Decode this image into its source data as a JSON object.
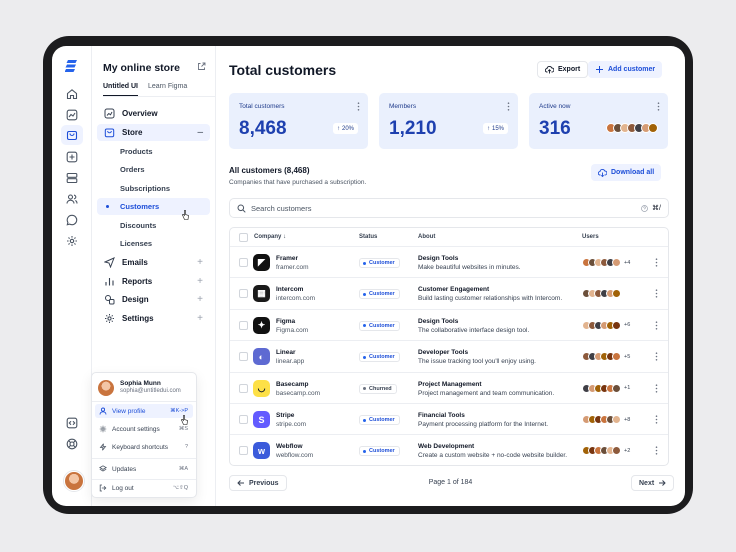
{
  "sidebar": {
    "store_title": "My online store",
    "tabs": [
      "Untitled UI",
      "Learn Figma"
    ],
    "nav": {
      "overview": "Overview",
      "store": "Store",
      "store_toggle": "–",
      "products": "Products",
      "orders": "Orders",
      "subscriptions": "Subscriptions",
      "customers": "Customers",
      "discounts": "Discounts",
      "licenses": "Licenses",
      "emails": "Emails",
      "reports": "Reports",
      "design": "Design",
      "settings": "Settings",
      "plus": "+"
    }
  },
  "account_menu": {
    "name": "Sophia Munn",
    "email": "sophia@untitledui.com",
    "items": [
      {
        "label": "View profile",
        "shortcut": "⌘K->P"
      },
      {
        "label": "Account settings",
        "shortcut": "⌘S"
      },
      {
        "label": "Keyboard shortcuts",
        "shortcut": "?"
      },
      {
        "label": "Updates",
        "shortcut": "⌘A"
      },
      {
        "label": "Log out",
        "shortcut": "⌥⇧Q"
      }
    ]
  },
  "header": {
    "title": "Total customers",
    "export_label": "Export",
    "add_label": "Add customer"
  },
  "stats": [
    {
      "label": "Total customers",
      "value": "8,468",
      "change": "20%"
    },
    {
      "label": "Members",
      "value": "1,210",
      "change": "15%"
    },
    {
      "label": "Active now",
      "value": "316"
    }
  ],
  "list": {
    "title": "All customers (8,468)",
    "subtitle": "Companies that have purchased a subscription.",
    "download_label": "Download all",
    "search_placeholder": "Search customers",
    "search_shortcut": "⌘/"
  },
  "table": {
    "columns": {
      "company": "Company",
      "status": "Status",
      "about": "About",
      "users": "Users"
    },
    "rows": [
      {
        "name": "Framer",
        "domain": "framer.com",
        "status": "Customer",
        "about_title": "Design Tools",
        "about_desc": "Make beautiful websites in minutes.",
        "more": "+4",
        "logo_color": "#111111",
        "logo_glyph": "◤"
      },
      {
        "name": "Intercom",
        "domain": "intercom.com",
        "status": "Customer",
        "about_title": "Customer Engagement",
        "about_desc": "Build lasting customer relationships with Intercom.",
        "more": "",
        "logo_color": "#1a1a1a",
        "logo_glyph": "▦"
      },
      {
        "name": "Figma",
        "domain": "Figma.com",
        "status": "Customer",
        "about_title": "Design Tools",
        "about_desc": "The collaborative interface design tool.",
        "more": "+6",
        "logo_color": "#111111",
        "logo_glyph": "✦"
      },
      {
        "name": "Linear",
        "domain": "linear.app",
        "status": "Customer",
        "about_title": "Developer Tools",
        "about_desc": "The issue tracking tool you'll enjoy using.",
        "more": "+5",
        "logo_color": "#5e6ad2",
        "logo_glyph": "◐"
      },
      {
        "name": "Basecamp",
        "domain": "basecamp.com",
        "status": "Churned",
        "about_title": "Project Management",
        "about_desc": "Project management and team communication.",
        "more": "+1",
        "logo_color": "#fde047",
        "logo_glyph": "◡"
      },
      {
        "name": "Stripe",
        "domain": "stripe.com",
        "status": "Customer",
        "about_title": "Financial Tools",
        "about_desc": "Payment processing platform for the Internet.",
        "more": "+8",
        "logo_color": "#635bff",
        "logo_glyph": "S"
      },
      {
        "name": "Webflow",
        "domain": "webflow.com",
        "status": "Customer",
        "about_title": "Web Development",
        "about_desc": "Create a custom website + no-code website builder.",
        "more": "+2",
        "logo_color": "#3b5bdb",
        "logo_glyph": "w"
      }
    ]
  },
  "pagination": {
    "previous": "Previous",
    "page_text": "Page 1 of 184",
    "next": "Next"
  },
  "colors": {
    "accent": "#1d4ed8",
    "card_bg": "#eaf0fd",
    "active_nav_bg": "#eef2ff"
  },
  "avatar_colors": [
    "#c9743e",
    "#6b4f3a",
    "#e2b48f",
    "#8d5a3c",
    "#3f3f46",
    "#d59b74",
    "#a16207",
    "#78350f"
  ]
}
